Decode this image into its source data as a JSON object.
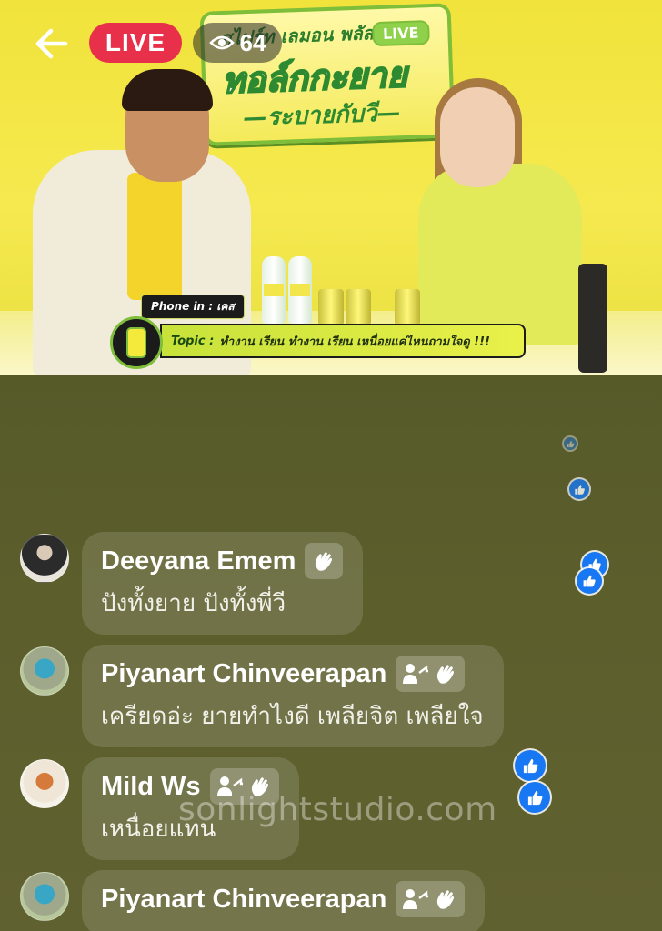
{
  "video": {
    "logo_top": "สไปร์ท เลมอน พลัส",
    "logo_live": "LIVE",
    "logo_main": "ทอล์กกะยาย",
    "logo_sub": "—ระบายกับวี—",
    "phone_in_label": "Phone in : เคส",
    "topic_prefix": "Topic :",
    "topic_text": "ทำงาน เรียน ทำงาน เรียน เหนื่อยแค่ไหนถามใจดู !!!",
    "can_label": "Sprite"
  },
  "overlay": {
    "back_icon": "back-arrow-icon",
    "live_label": "LIVE",
    "viewer_icon": "eye-icon",
    "viewer_count": "64",
    "live_color": "#e8304a"
  },
  "comments": [
    {
      "name": "Deeyana Emem",
      "message": "ปังทั้งยาย ปังทั้งพี่วี",
      "badges": [
        "wave-icon"
      ]
    },
    {
      "name": "Piyanart Chinveerapan",
      "message": "เครียดอ่ะ ยายทำไงดี เพลียจิต เพลียใจ",
      "badges": [
        "share-icon",
        "wave-icon"
      ]
    },
    {
      "name": "Mild Ws",
      "message": "เหนื่อยแทน",
      "badges": [
        "share-icon",
        "wave-icon"
      ]
    },
    {
      "name": "Piyanart Chinveerapan",
      "message": "",
      "badges": [
        "share-icon",
        "wave-icon"
      ]
    }
  ],
  "reactions": {
    "icon": "like-icon",
    "color": "#1877f2"
  },
  "watermark": "sonlightstudio.com"
}
